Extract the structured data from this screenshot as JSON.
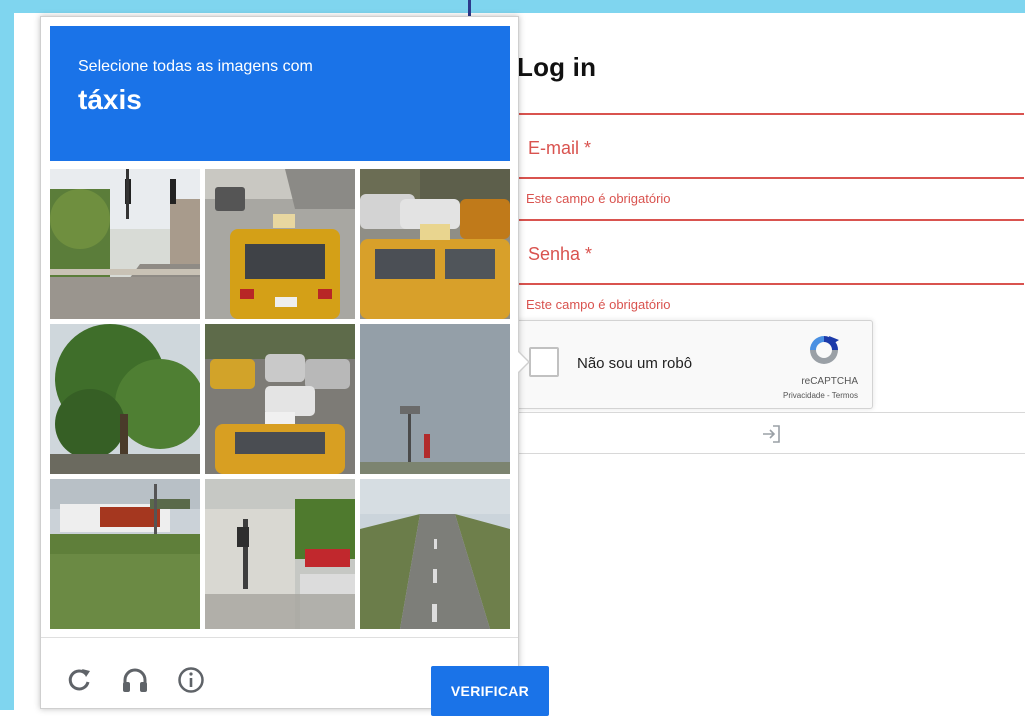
{
  "login": {
    "title": "Log in",
    "email_label": "E-mail *",
    "email_error": "Este campo é obrigatório",
    "password_label": "Senha *",
    "password_error": "Este campo é obrigatório"
  },
  "recaptcha": {
    "checkbox_label": "Não sou um robô",
    "brand": "reCAPTCHA",
    "links": "Privacidade - Termos"
  },
  "submit": {
    "icon": "login-arrow-icon"
  },
  "challenge": {
    "instruction": "Selecione todas as imagens com",
    "target": "táxis",
    "verify_label": "VERIFICAR",
    "tiles": [
      {
        "scene": "street-traffic-lights"
      },
      {
        "scene": "yellow-taxi"
      },
      {
        "scene": "yellow-taxi-traffic"
      },
      {
        "scene": "green-tree"
      },
      {
        "scene": "taxi-busy-street"
      },
      {
        "scene": "sky-pole"
      },
      {
        "scene": "truck-grass"
      },
      {
        "scene": "street-corner-sign"
      },
      {
        "scene": "empty-road"
      }
    ],
    "footer_icons": [
      "reload-icon",
      "audio-headphones-icon",
      "info-icon"
    ]
  },
  "colors": {
    "accent": "#1a73e8",
    "error": "#d9534f",
    "background_band": "#7fd5ef"
  }
}
